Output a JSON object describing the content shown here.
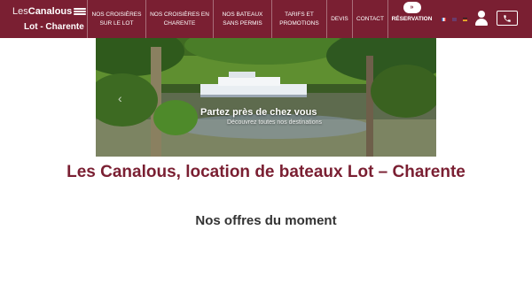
{
  "brand": {
    "les": "Les",
    "name": "Canalous",
    "sub": "Lot - Charente"
  },
  "nav": {
    "items": [
      {
        "line1": "NOS CROISIÈRES",
        "line2": "SUR LE LOT"
      },
      {
        "line1": "NOS CROISIÈRES EN",
        "line2": "CHARENTE"
      },
      {
        "line1": "NOS BATEAUX",
        "line2": "SANS PERMIS"
      },
      {
        "line1": "TARIFS ET",
        "line2": "PROMOTIONS"
      },
      {
        "line1": "DEVIS",
        "line2": ""
      },
      {
        "line1": "CONTACT",
        "line2": ""
      }
    ],
    "reservation": "RÉSERVATION",
    "reservation_badge": "»"
  },
  "icons": {
    "user": "user-icon",
    "phone": "phone-icon",
    "prev": "chevron-left-icon"
  },
  "colors": {
    "brand": "#7a1f32",
    "white": "#ffffff",
    "section_title": "#333333"
  },
  "hero": {
    "caption": "Partez près de chez vous",
    "subcaption": "Découvrez toutes nos destinations",
    "prev_arrow": "‹"
  },
  "main": {
    "title": "Les Canalous, location de bateaux Lot – Charente",
    "offers_title": "Nos offres du moment"
  }
}
